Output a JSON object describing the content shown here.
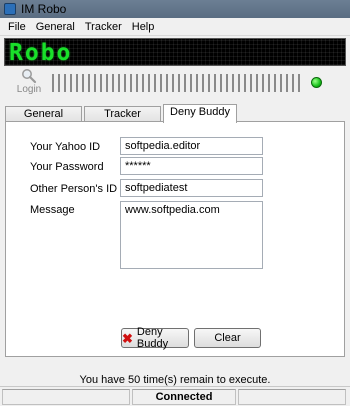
{
  "window": {
    "title": "IM Robo"
  },
  "menu": {
    "items": [
      "File",
      "General",
      "Tracker",
      "Help"
    ]
  },
  "banner": {
    "text": "Robo",
    "color": "#19e02a"
  },
  "toolbar": {
    "login_label": "Login",
    "login_icon": "magnifier-icon",
    "status_led_color": "#17c21a"
  },
  "tabs": {
    "general": "General",
    "tracker": "Tracker",
    "deny_buddy": "Deny Buddy",
    "active": "Deny Buddy"
  },
  "form": {
    "yahoo_id_label": "Your Yahoo ID",
    "yahoo_id_value": "softpedia.editor",
    "password_label": "Your Password",
    "password_value": "******",
    "other_id_label": "Other Person's ID",
    "other_id_value": "softpediatest",
    "message_label": "Message",
    "message_value": "www.softpedia.com"
  },
  "buttons": {
    "deny_buddy": "Deny Buddy",
    "clear": "Clear"
  },
  "footer": {
    "exec_message": "You have 50 time(s) remain to execute."
  },
  "status": {
    "connection": "Connected"
  }
}
